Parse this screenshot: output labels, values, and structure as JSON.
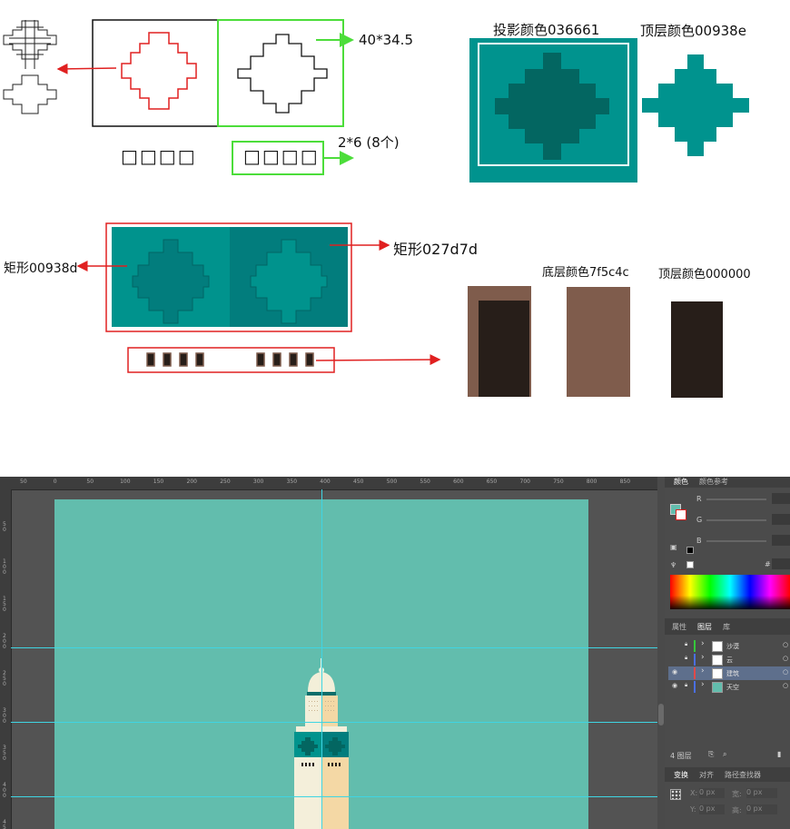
{
  "top": {
    "dim_label": "40*34.5",
    "placeholder_boxes_left": "□□□□",
    "placeholder_boxes_green": "□□□□",
    "count_label": "2*6 (8个)",
    "shadow_color_label": "投影颜色036661",
    "top_color_label": "顶层颜色00938e"
  },
  "middle": {
    "rect_right_label": "矩形027d7d",
    "rect_left_label": "矩形00938d",
    "bottom_color_label": "底层颜色7f5c4c",
    "top_color_label2": "顶层颜色000000"
  },
  "colors": {
    "teal_top": "#00938e",
    "teal_shadow": "#036661",
    "teal_dark": "#027d7d",
    "brown": "#7f5c4c",
    "window_dark": "#271e19",
    "red": "#e02020",
    "green": "#4cdd3a",
    "sky": "#62bdad"
  },
  "app": {
    "ruler_marks": [
      "50",
      "0",
      "50",
      "100",
      "150",
      "200",
      "250",
      "300",
      "350",
      "400",
      "450",
      "500",
      "550",
      "600",
      "650",
      "700",
      "750",
      "800",
      "850"
    ],
    "ruler_v_marks": [
      "5 0",
      "1 0 0",
      "1 5 0",
      "2 0 0",
      "2 5 0",
      "3 0 0",
      "3 5 0",
      "4 0 0",
      "4 5"
    ],
    "color_panel": {
      "tab_color": "颜色",
      "tab_guide": "颜色参考",
      "r": "R",
      "g": "G",
      "b": "B",
      "hex": "#"
    },
    "layers_panel": {
      "tab_properties": "属性",
      "tab_layers": "图层",
      "tab_library": "库",
      "layers": [
        {
          "name": "沙漠",
          "color": "#35c73a"
        },
        {
          "name": "云",
          "color": "#4a6ee0"
        },
        {
          "name": "建筑",
          "color": "#e04a4a"
        },
        {
          "name": "天空",
          "color": "#4a6ee0"
        }
      ],
      "footer_label": "4 图层"
    },
    "transform_panel": {
      "tab_transform": "变换",
      "tab_align": "对齐",
      "tab_pathfinder": "路径查找器",
      "x_label": "X:",
      "x_value": "0 px",
      "y_label": "Y:",
      "y_value": "0 px",
      "w_label": "宽:",
      "w_value": "0 px",
      "h_label": "高:",
      "h_value": "0 px"
    }
  }
}
